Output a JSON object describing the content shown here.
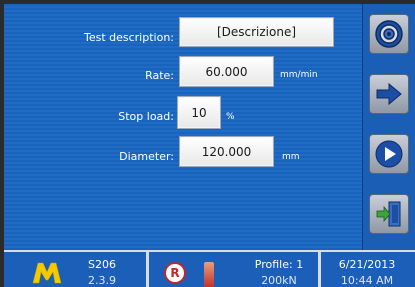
{
  "form": {
    "test_description": {
      "label": "Test description:",
      "value": "[Descrizione]"
    },
    "rate": {
      "label": "Rate:",
      "value": "60.000",
      "unit": "mm/min"
    },
    "stop_load": {
      "label": "Stop load:",
      "value": "10",
      "unit": "%"
    },
    "diameter": {
      "label": "Diameter:",
      "value": "120.000",
      "unit": "mm"
    }
  },
  "sidebar": {
    "buttons": [
      {
        "icon": "target-settings-icon"
      },
      {
        "icon": "arrow-right-icon"
      },
      {
        "icon": "play-icon"
      },
      {
        "icon": "exit-door-icon"
      }
    ]
  },
  "status": {
    "logo": "M",
    "system_name": "S206",
    "version": "2.3.9",
    "profile": "Profile: 1",
    "capacity": "200kN",
    "date": "6/21/2013",
    "time": "10:44 AM"
  },
  "colors": {
    "screen_blue": "#1a63bb",
    "logo_yellow": "#f5c800",
    "accent_red": "#c0282a"
  }
}
